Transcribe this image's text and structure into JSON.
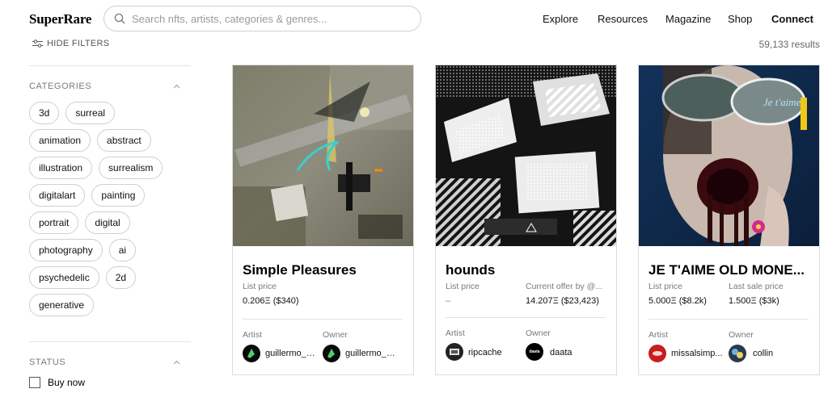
{
  "header": {
    "logo": "SuperRare",
    "search_placeholder": "Search nfts, artists, categories & genres...",
    "nav": [
      "Explore",
      "Resources",
      "Magazine",
      "Shop",
      "Connect"
    ]
  },
  "filters": {
    "hide_label": "HIDE FILTERS",
    "results": "59,133 results",
    "categories_title": "CATEGORIES",
    "category_rows": [
      [
        "3d",
        "surreal"
      ],
      [
        "animation",
        "abstract"
      ],
      [
        "illustration",
        "surrealism"
      ],
      [
        "digitalart",
        "painting"
      ],
      [
        "portrait",
        "digital"
      ],
      [
        "photography",
        "ai"
      ],
      [
        "psychedelic",
        "2d"
      ],
      [
        "generative"
      ]
    ],
    "status_title": "STATUS",
    "buy_now": "Buy now"
  },
  "cards": [
    {
      "title": "Simple Pleasures",
      "price_label": "List price",
      "price_value": "0.206Ξ ($340)",
      "second_label": "",
      "second_value": "",
      "artist_label": "Artist",
      "artist": "guillermo_a...",
      "owner_label": "Owner",
      "owner": "guillermo_a..."
    },
    {
      "title": "hounds",
      "price_label": "List price",
      "price_value": "–",
      "second_label": "Current offer by @...",
      "second_value": "14.207Ξ ($23,423)",
      "artist_label": "Artist",
      "artist": "ripcache",
      "owner_label": "Owner",
      "owner": "daata",
      "owner_avatar_text": "daata"
    },
    {
      "title": "JE T'AIME OLD MONE...",
      "price_label": "List price",
      "price_value": "5.000Ξ ($8.2k)",
      "second_label": "Last sale price",
      "second_value": "1.500Ξ ($3k)",
      "artist_label": "Artist",
      "artist": "missalsimp...",
      "owner_label": "Owner",
      "owner": "collin",
      "art_text": "Je t'aime"
    }
  ],
  "colors": {
    "accent": "#000000",
    "border": "#cfcfcf",
    "muted": "#7a7a7a"
  }
}
